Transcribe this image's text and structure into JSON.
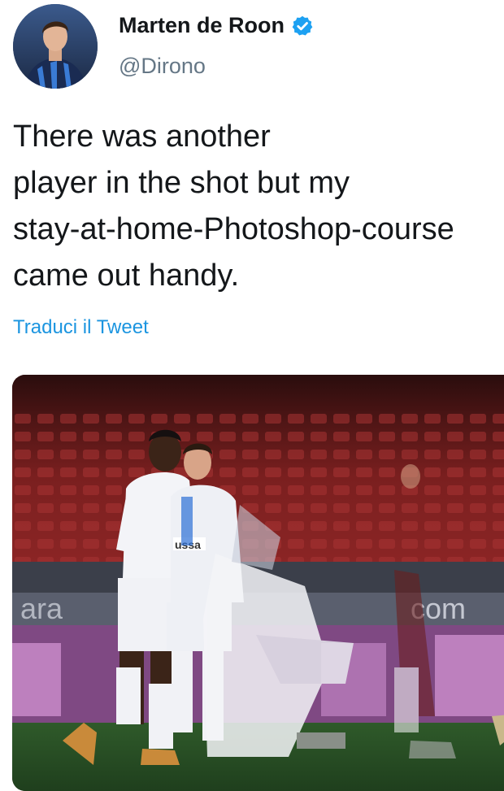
{
  "author": {
    "display_name": "Marten de Roon",
    "handle": "@Dirono",
    "verified": true,
    "avatar_icon": "profile-photo"
  },
  "tweet": {
    "lines": [
      "There was another",
      "player in the shot but my",
      "stay-at-home-Photoshop-course",
      "came out handy."
    ],
    "translate_label": "Traduci il Tweet"
  },
  "media": {
    "type": "photo",
    "description_icon": "football-celebration-photo",
    "visible_board_text": "com",
    "visible_shirt_text": "ussa"
  },
  "colors": {
    "link": "#1b95e0",
    "verified": "#1da1f2",
    "text": "#14171a",
    "secondary": "#657786"
  }
}
